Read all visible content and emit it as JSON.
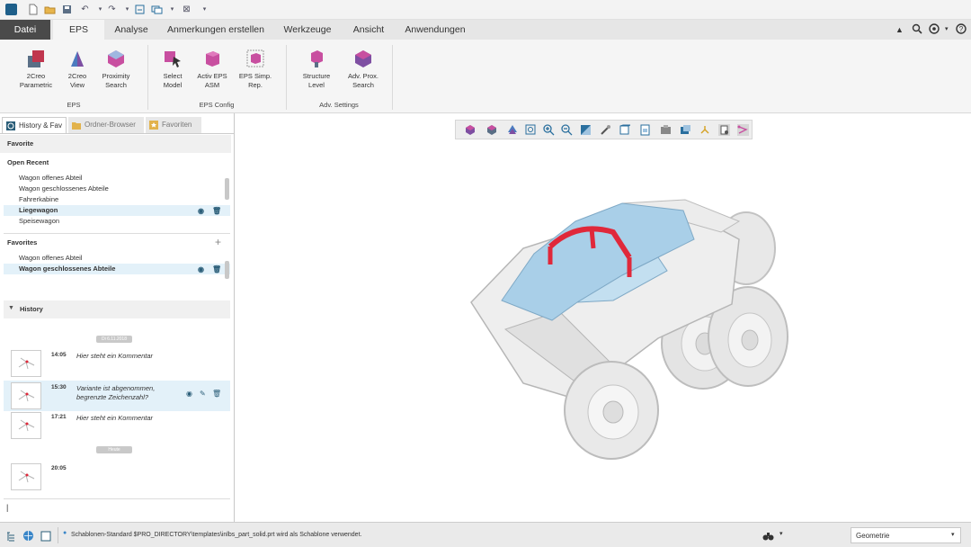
{
  "tabs": {
    "file": "Datei",
    "eps": "EPS",
    "analyse": "Analyse",
    "annotations": "Anmerkungen erstellen",
    "tools": "Werkzeuge",
    "view": "Ansicht",
    "apps": "Anwendungen"
  },
  "ribbon": {
    "btn_2creo_param": [
      "2Creo",
      "Parametric"
    ],
    "btn_2creo_view": [
      "2Creo",
      "View"
    ],
    "btn_prox_search": [
      "Proximity",
      "Search"
    ],
    "btn_select_model": [
      "Select",
      "Model"
    ],
    "btn_activ_eps": [
      "Activ EPS",
      "ASM"
    ],
    "btn_eps_simp": [
      "EPS Simp.",
      "Rep."
    ],
    "btn_structure": [
      "Structure",
      "Level"
    ],
    "btn_adv_prox": [
      "Adv. Prox.",
      "Search"
    ],
    "group_eps": "EPS",
    "group_eps_config": "EPS Config",
    "group_adv": "Adv. Settings"
  },
  "panel": {
    "tab_history": "History & Fav",
    "tab_browser": "Ordner-Browser",
    "tab_favorites": "Favoriten",
    "favorite_heading": "Favorite",
    "open_recent_heading": "Open Recent",
    "recent": [
      "Wagon offenes Abteil",
      "Wagon geschlossenes Abteile",
      "Fahrerkabine",
      "Liegewagon",
      "Speisewagon"
    ],
    "favorites_heading": "Favorites",
    "favorites": [
      "Wagon offenes Abteil",
      "Wagon geschlossenes Abteile"
    ],
    "history_heading": "History",
    "history_date1": "Di 6.11.2018",
    "history_date2": "Heute",
    "history": [
      {
        "time": "14:05",
        "comment": "Hier steht ein Kommentar"
      },
      {
        "time": "15:30",
        "comment": "Variante ist abgenommen, begrenzte Zeichenzahl?"
      },
      {
        "time": "17:21",
        "comment": "Hier steht ein Kommentar"
      },
      {
        "time": "20:05",
        "comment": ""
      }
    ],
    "input_value": "|"
  },
  "status": {
    "message": "Schablonen-Standard $PRO_DIRECTORY\\templates\\inlbs_part_solid.prt wird als Schablone verwendet.",
    "filter": "Geometrie"
  },
  "colors": {
    "accent_blue": "#2a5d78",
    "selection_bg": "#e3f1f9",
    "highlight_red": "#e0283a",
    "surface_blue": "#a9cfe8"
  }
}
